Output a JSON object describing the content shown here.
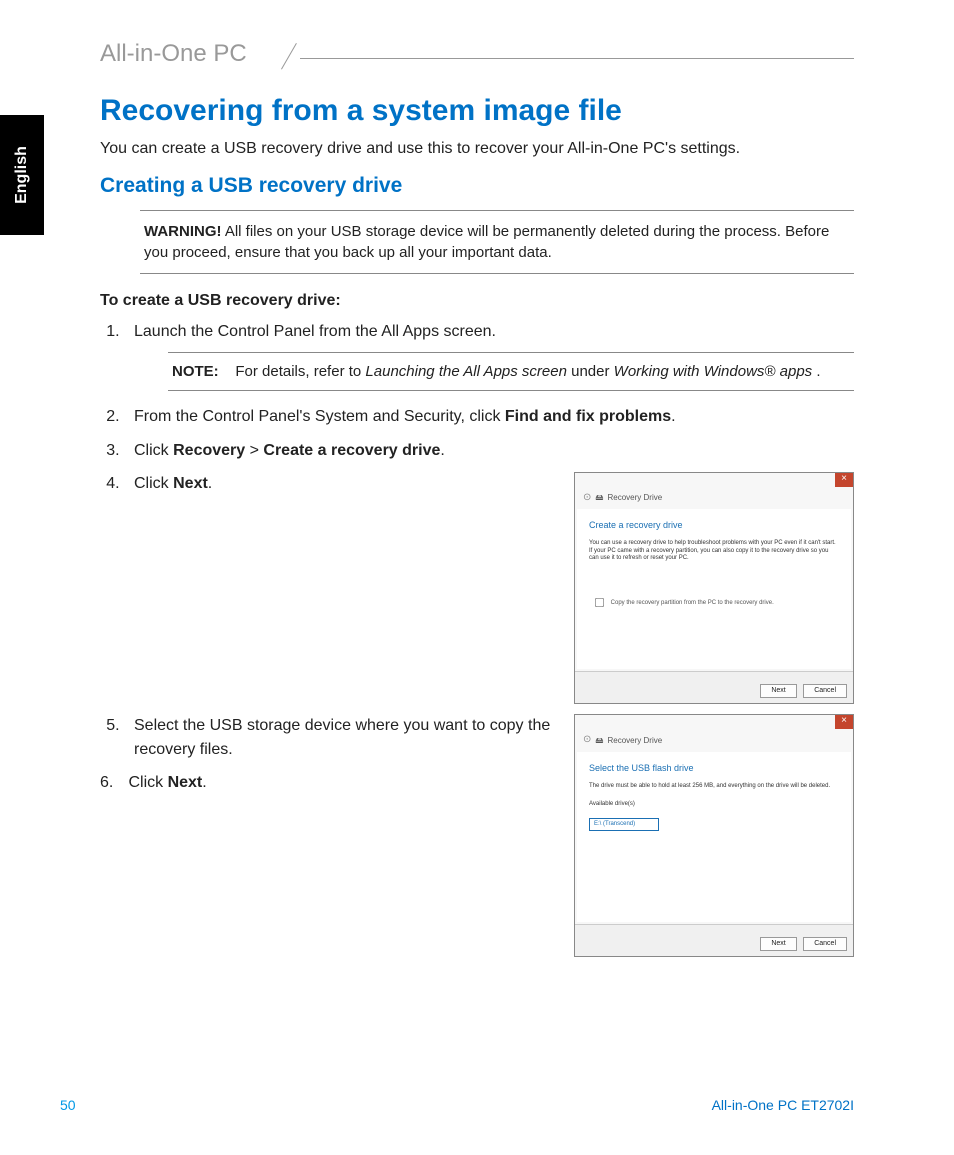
{
  "brand": "All-in-One PC",
  "languageTab": "English",
  "heading1": "Recovering from a system image file",
  "intro": "You can create a USB recovery drive and use this to recover your All-in-One PC's settings.",
  "heading2": "Creating a USB recovery drive",
  "warning": {
    "label": "WARNING!",
    "text": "All files on your USB storage device will be permanently deleted during the process. Before you proceed, ensure that you back up all your important data."
  },
  "subheading": "To create a USB recovery drive:",
  "step1": "Launch the Control Panel from the All Apps screen.",
  "note": {
    "label": "NOTE:",
    "prefix": "For details, refer to ",
    "em1": "Launching the All Apps screen",
    "mid": " under ",
    "em2": "Working with Windows® apps",
    "suffix": "."
  },
  "step2": {
    "pre": "From the Control Panel's System and Security, click ",
    "b1": "Find and fix problems",
    "post": "."
  },
  "step3": {
    "pre": "Click ",
    "b1": "Recovery",
    "mid": " > ",
    "b2": "Create a recovery drive",
    "post": "."
  },
  "step4": {
    "pre": "Click ",
    "b1": "Next",
    "post": "."
  },
  "step5": "Select the USB storage device where you want to copy the recovery files.",
  "step6": {
    "pre": "Click ",
    "b1": "Next",
    "post": "."
  },
  "shot1": {
    "breadcrumb": "Recovery Drive",
    "title": "Create a recovery drive",
    "body": "You can use a recovery drive to help troubleshoot problems with your PC even if it can't start. If your PC came with a recovery partition, you can also copy it to the recovery drive so you can use it to refresh or reset your PC.",
    "checkbox": "Copy the recovery partition from the PC to the recovery drive.",
    "btnNext": "Next",
    "btnCancel": "Cancel",
    "closeGlyph": "×"
  },
  "shot2": {
    "breadcrumb": "Recovery Drive",
    "title": "Select the USB flash drive",
    "body": "The drive must be able to hold at least 256 MB, and everything on the drive will be deleted.",
    "availLabel": "Available drive(s)",
    "driveItem": "E:\\ (Transcend)",
    "btnNext": "Next",
    "btnCancel": "Cancel",
    "closeGlyph": "×"
  },
  "footer": {
    "page": "50",
    "model": "All-in-One PC ET2702I"
  }
}
